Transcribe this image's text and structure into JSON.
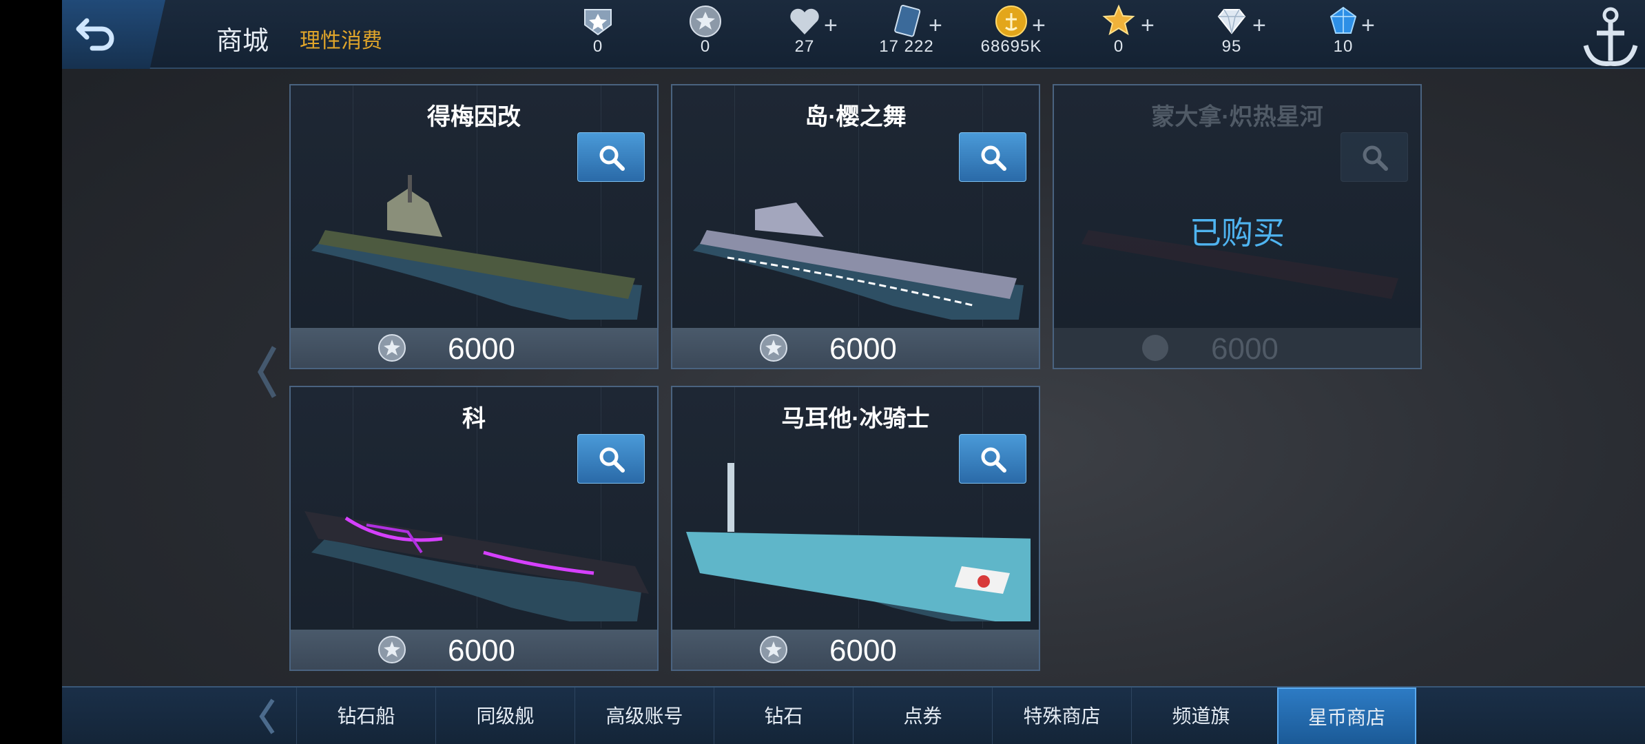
{
  "header": {
    "title": "商城",
    "subtitle": "理性消费"
  },
  "currencies": [
    {
      "name": "rank-badge",
      "value": "0",
      "plus": false
    },
    {
      "name": "star-coin",
      "value": "0",
      "plus": false
    },
    {
      "name": "heart",
      "value": "27",
      "plus": true
    },
    {
      "name": "card",
      "value": "17 222",
      "plus": true
    },
    {
      "name": "gold-coin",
      "value": "68695K",
      "plus": true
    },
    {
      "name": "gold-star",
      "value": "0",
      "plus": true
    },
    {
      "name": "diamond",
      "value": "95",
      "plus": true
    },
    {
      "name": "blue-gem",
      "value": "10",
      "plus": true
    }
  ],
  "items": [
    {
      "name": "得梅因改",
      "price": "6000",
      "status": ""
    },
    {
      "name": "岛·樱之舞",
      "price": "6000",
      "status": ""
    },
    {
      "name": "蒙大拿·炽热星河",
      "price": "6000",
      "status": "已购买"
    },
    {
      "name": "科",
      "price": "6000",
      "status": ""
    },
    {
      "name": "马耳他·冰骑士",
      "price": "6000",
      "status": ""
    }
  ],
  "tabs": [
    "钻石船",
    "同级舰",
    "高级账号",
    "钻石",
    "点券",
    "特殊商店",
    "频道旗",
    "星币商店"
  ],
  "active_tab": "星币商店"
}
